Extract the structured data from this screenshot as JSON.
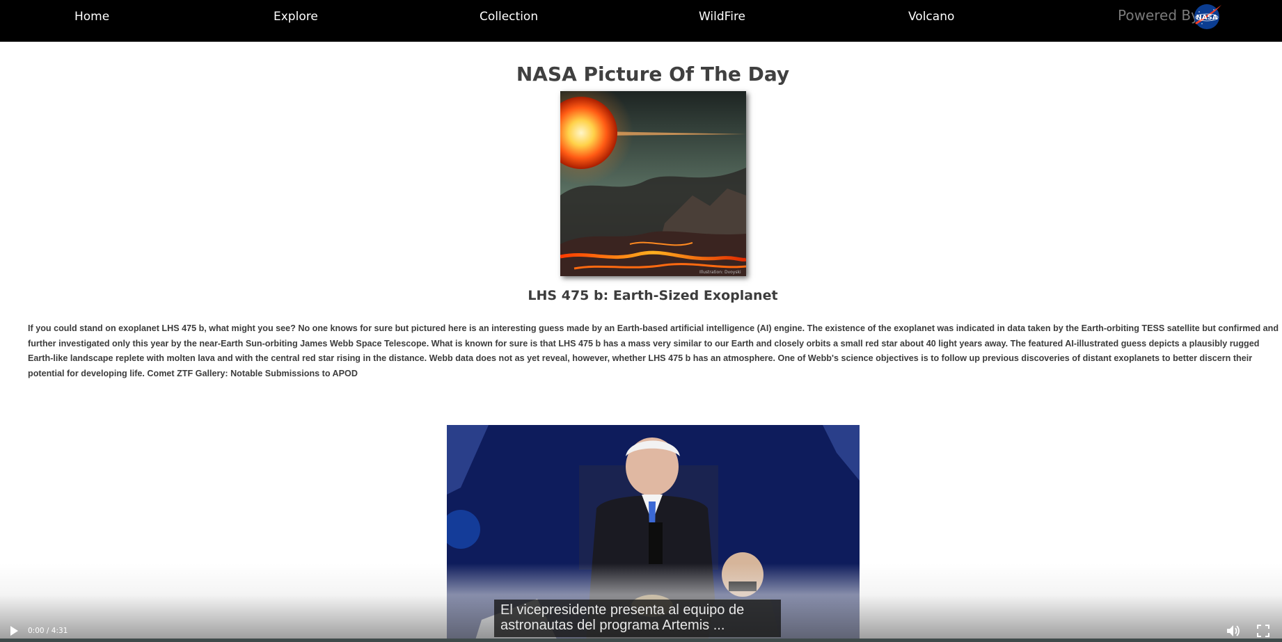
{
  "nav": {
    "links": [
      "Home",
      "Explore",
      "Collection",
      "WildFire",
      "Volcano"
    ],
    "powered_by": "Powered By",
    "logo_text": "NASA"
  },
  "main": {
    "page_title": "NASA Picture Of The Day",
    "image_title": "LHS 475 b: Earth-Sized Exoplanet",
    "explanation": "If you could stand on exoplanet LHS 475 b, what might you see? No one knows for sure but pictured here is an interesting guess made by an Earth-based artificial intelligence (AI) engine. The existence of the exoplanet was indicated in data taken by the Earth-orbiting TESS satellite but confirmed and further investigated only this year by the near-Earth Sun-orbiting James Webb Space Telescope. What is known for sure is that LHS 475 b has a mass very similar to our Earth and closely orbits a small red star about 40 light years away. The featured AI-illustrated guess depicts a plausibly rugged Earth-like landscape replete with molten lava and with the central red star rising in the distance. Webb data does not as yet reveal, however, whether LHS 475 b has an atmosphere. One of Webb's science objectives is to follow up previous discoveries of distant exoplanets to better discern their potential for developing life. Comet ZTF Gallery: Notable Submissions to APOD",
    "image_watermark": "Illustration: Dvoyski"
  },
  "video": {
    "caption_line1": "El vicepresidente presenta al equipo de",
    "caption_line2": "astronautas del programa  Artemis ...",
    "time": "0:00 / 4:31",
    "progress": 0
  },
  "icons": {
    "play": "play-icon",
    "volume": "volume-icon",
    "fullscreen": "fullscreen-icon"
  }
}
